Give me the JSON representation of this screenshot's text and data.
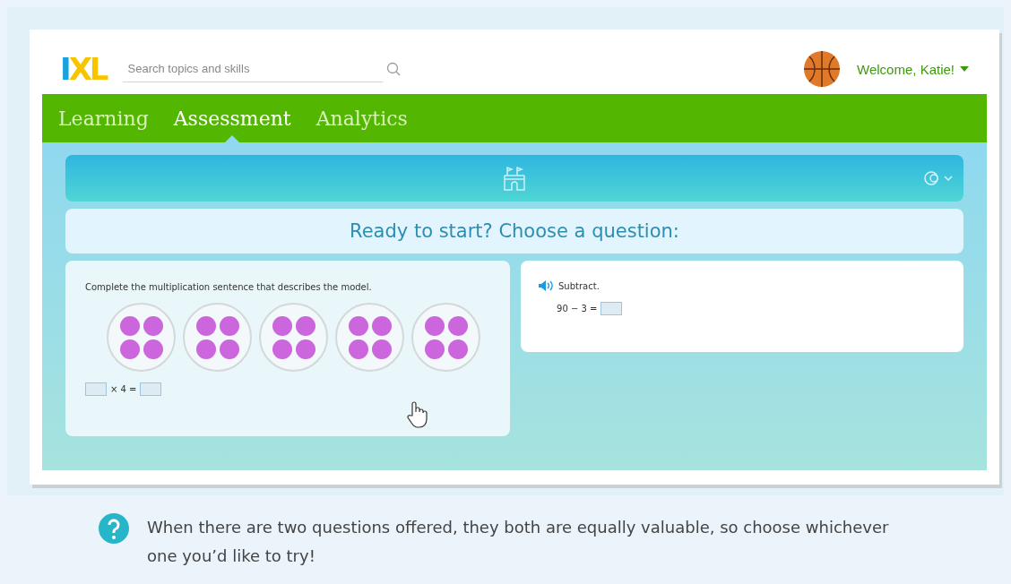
{
  "header": {
    "logo": "IXL",
    "search": {
      "placeholder": "Search topics and skills"
    },
    "welcome": "Welcome, Katie!"
  },
  "nav": {
    "tabs": [
      {
        "label": "Learning",
        "selected": false
      },
      {
        "label": "Assessment",
        "selected": true
      },
      {
        "label": "Analytics",
        "selected": false
      }
    ]
  },
  "prompt": "Ready to start? Choose a question:",
  "questions": [
    {
      "kind": "groups",
      "instruction": "Complete the multiplication sentence that describes the model.",
      "equation_middle": "× 4 =",
      "hovered": true
    },
    {
      "kind": "subtract",
      "instruction": "Subtract.",
      "equation": "90 − 3 =",
      "hovered": false
    }
  ],
  "tip": "When there are two questions offered, they both are equally valuable, so choose whichever one you’d like to try!"
}
